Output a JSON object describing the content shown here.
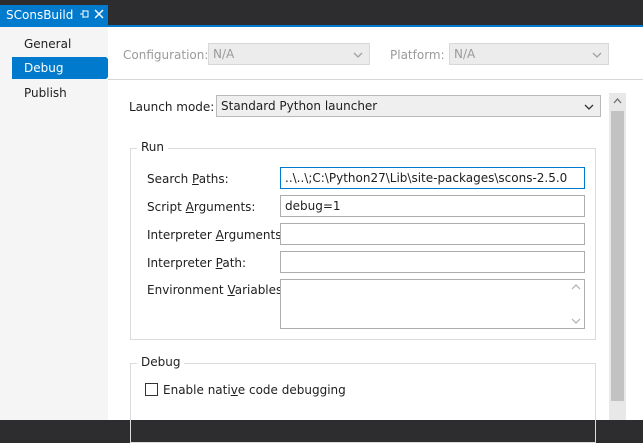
{
  "tab": {
    "title": "SConsBuild",
    "pin_glyph": "⊣",
    "close_glyph": "✕"
  },
  "sidebar": {
    "items": [
      {
        "label": "General"
      },
      {
        "label": "Debug"
      },
      {
        "label": "Publish"
      }
    ],
    "selected": "Debug"
  },
  "config_bar": {
    "configuration_label": "Configuration:",
    "configuration_value": "N/A",
    "platform_label": "Platform:",
    "platform_value": "N/A"
  },
  "launch": {
    "label": "Launch mode:",
    "value": "Standard Python launcher"
  },
  "run_group": {
    "title": "Run",
    "search_paths": {
      "label_pre": "Search ",
      "label_u": "P",
      "label_post": "aths:",
      "value": "..\\..\\;C:\\Python27\\Lib\\site-packages\\scons-2.5.0"
    },
    "script_arguments": {
      "label_pre": "Script ",
      "label_u": "A",
      "label_post": "rguments:",
      "value": "debug=1"
    },
    "interpreter_arguments": {
      "label_pre": "Interpreter ",
      "label_u": "A",
      "label_post": "rguments:",
      "value": ""
    },
    "interpreter_path": {
      "label_pre": "Interpreter ",
      "label_u": "P",
      "label_post": "ath:",
      "value": ""
    },
    "environment_variables": {
      "label_pre": "Environment ",
      "label_u": "V",
      "label_post": "ariables:",
      "value": ""
    }
  },
  "debug_group": {
    "title": "Debug",
    "native_debug": {
      "label_pre": "Enable nati",
      "label_u": "v",
      "label_post": "e code debugging",
      "checked": false
    }
  },
  "colors": {
    "accent": "#007acc",
    "chrome": "#2d2d30",
    "sidebar_bg": "#f5f5f5"
  }
}
